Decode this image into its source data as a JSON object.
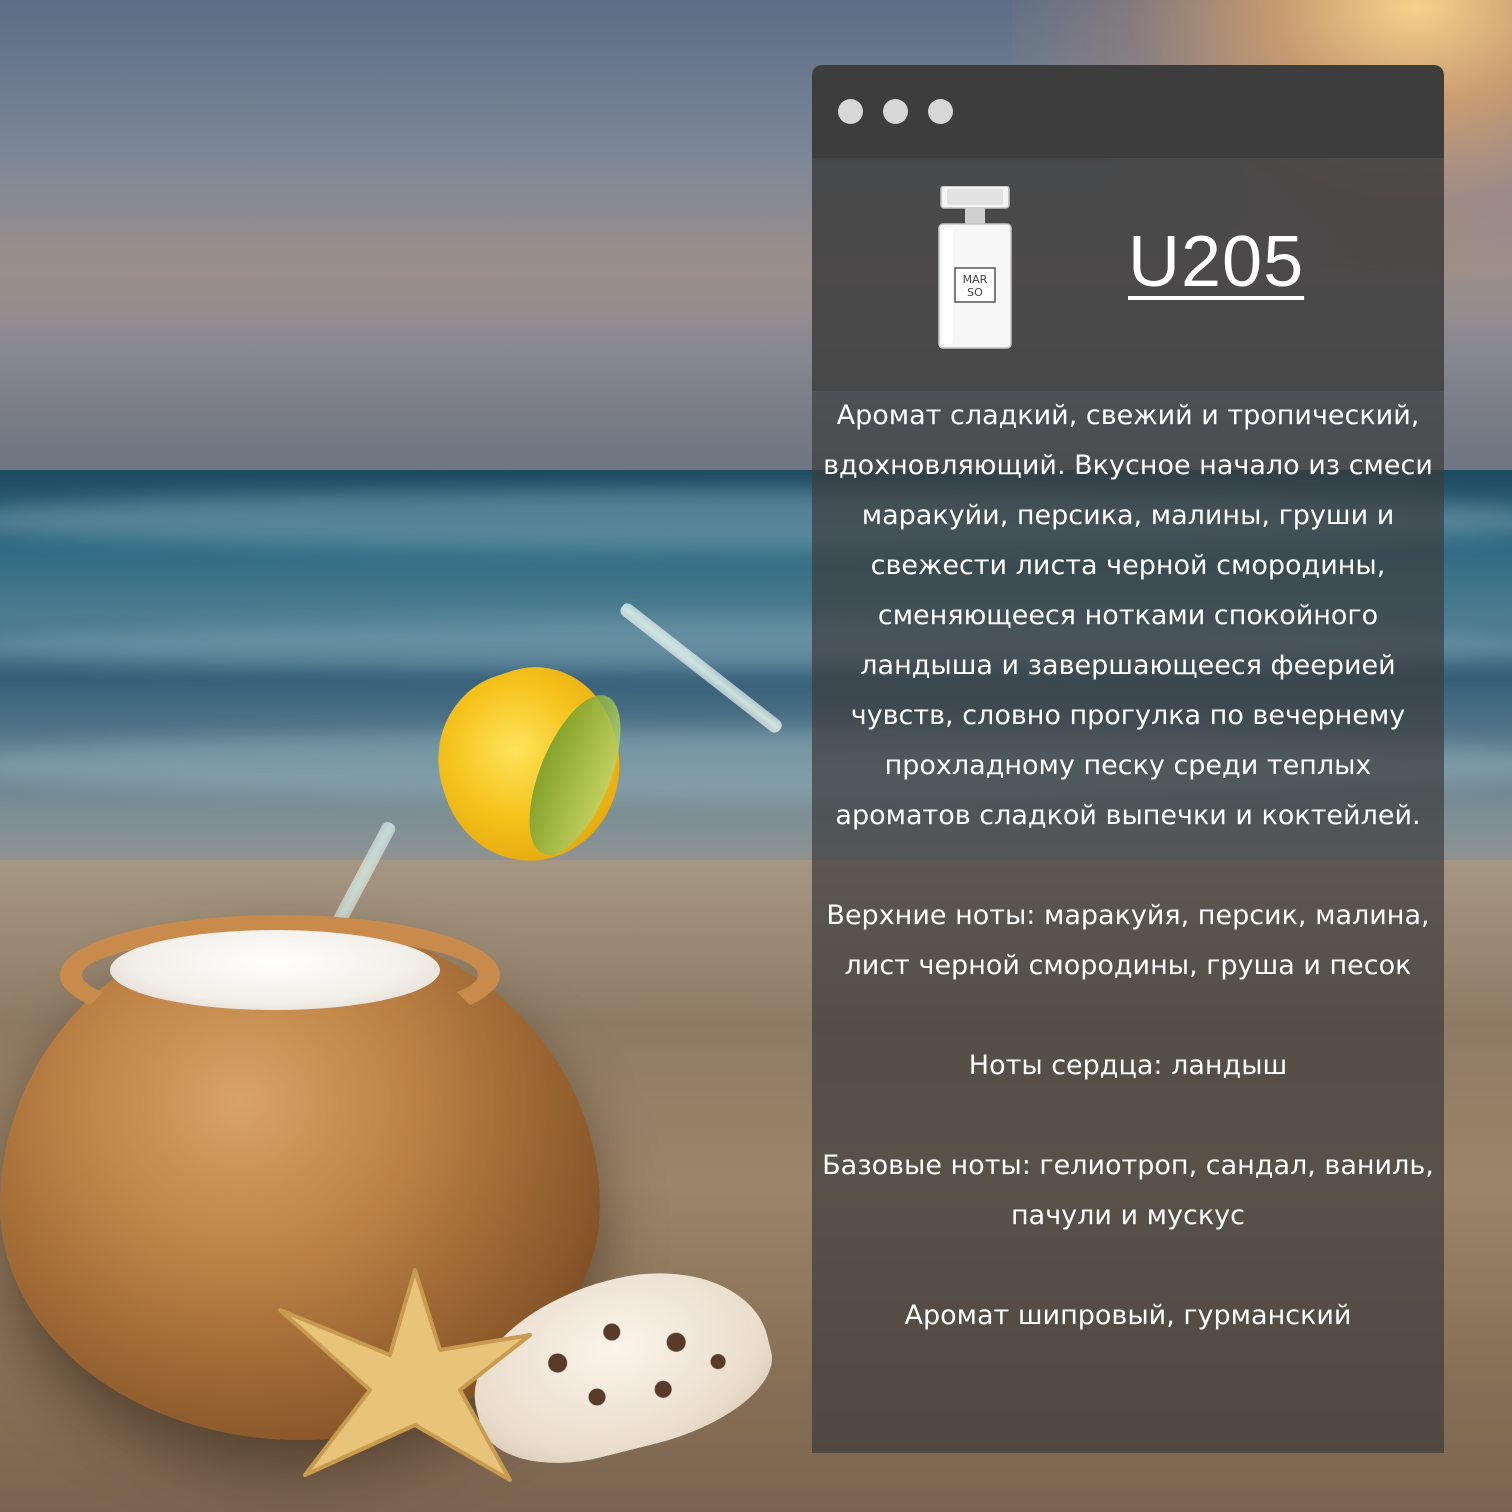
{
  "window": {
    "traffic_lights": [
      "window-dot-1",
      "window-dot-2",
      "window-dot-3"
    ],
    "colors": {
      "titlebar": "#3d3d3d",
      "dot": "#d7d7d7",
      "text": "#ffffff"
    }
  },
  "product": {
    "code": "U205",
    "bottle_label_line1": "MAR",
    "bottle_label_line2": "SO"
  },
  "content": {
    "description": "Аромат сладкий, свежий и тропический, вдохновляющий. Вкусное начало из смеси маракуйи, персика, малины, груши и свежести листа черной смородины, сменяющееся нотками спокойного ландыша и завершающееся феерией чувств, словно прогулка по вечернему прохладному песку среди теплых ароматов сладкой выпечки и коктейлей.",
    "top_notes": "Верхние ноты: маракуйя, персик, малина, лист черной смородины, груша и песок",
    "heart_notes": "Ноты сердца: ландыш",
    "base_notes": "Базовые ноты: гелиотроп, сандал, ваниль, пачули и мускус",
    "character": "Аромат шипровый, гурманский"
  }
}
